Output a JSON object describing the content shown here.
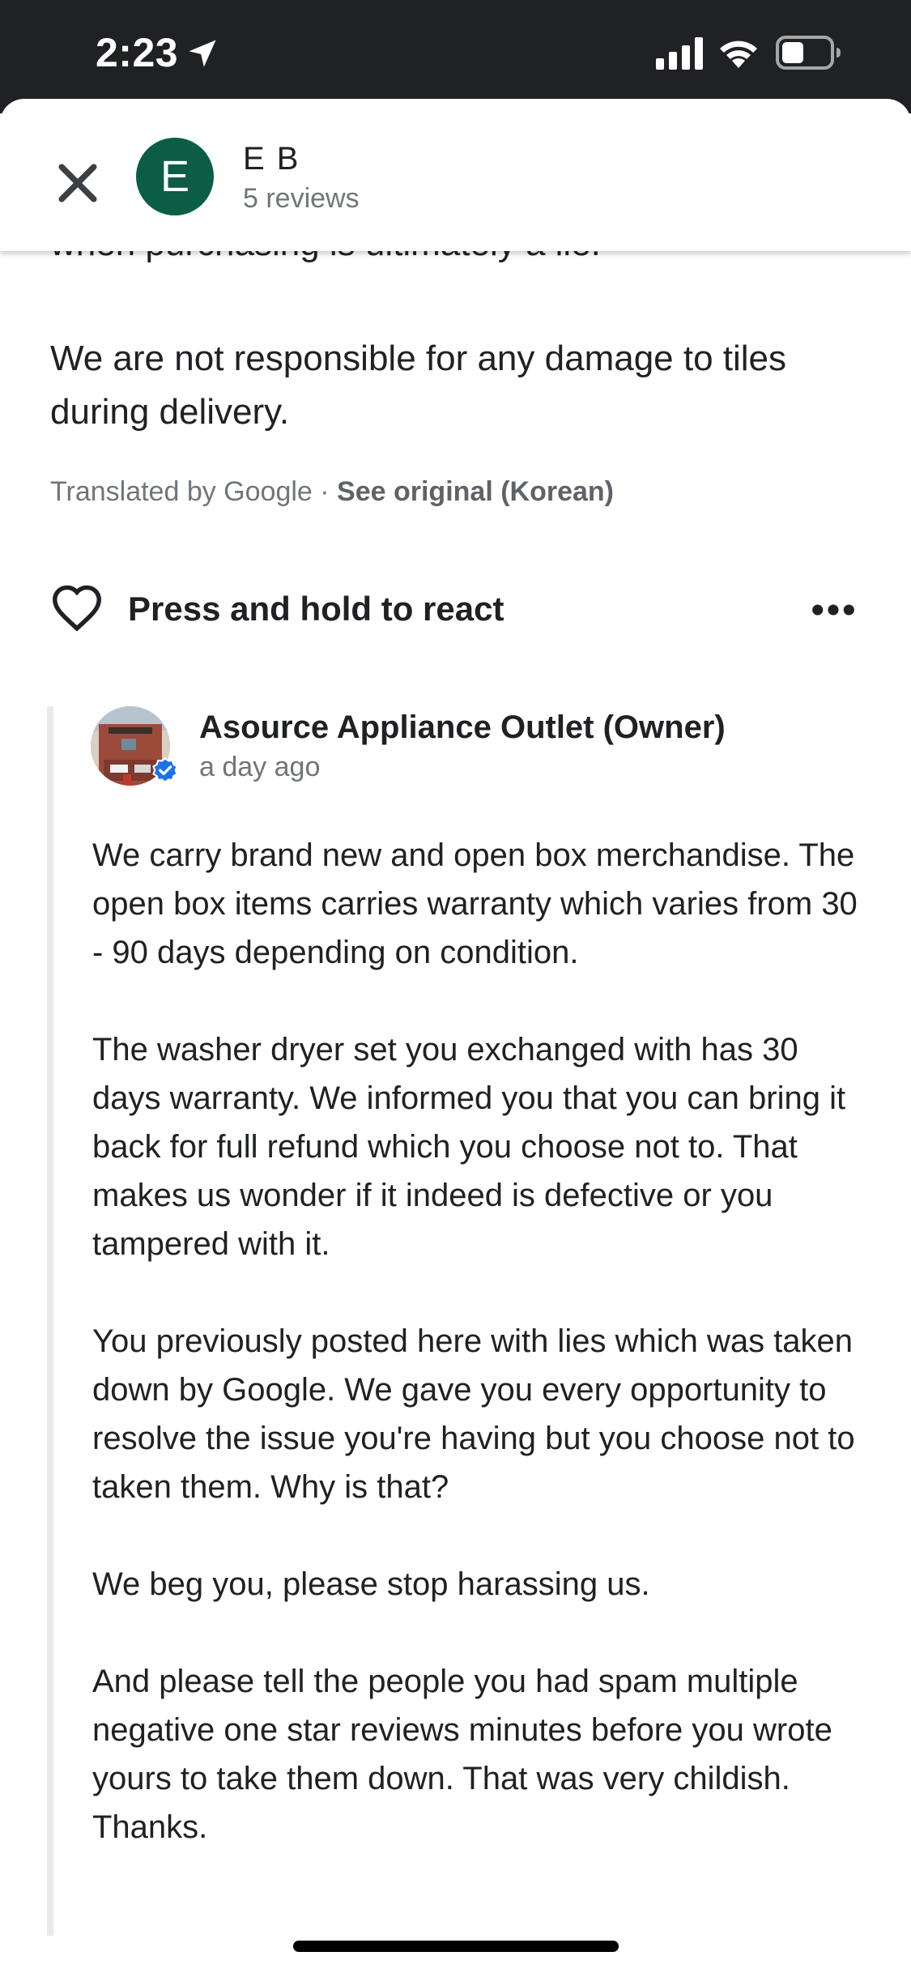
{
  "status_bar": {
    "time": "2:23"
  },
  "header": {
    "avatar_letter": "E",
    "reviewer_name": "E B",
    "review_count": "5 reviews",
    "avatar_color": "#0b5e45"
  },
  "review": {
    "clipped_line": "when purchasing is ultimately a lie.",
    "text": "We are not responsible for any damage to tiles during delivery.",
    "translated_by": "Translated by Google · ",
    "see_original": "See original (Korean)"
  },
  "reaction": {
    "label": "Press and hold to react"
  },
  "owner_reply": {
    "name": "Asource Appliance Outlet (Owner)",
    "time": "a day ago",
    "paragraphs": [
      "We carry brand new and open box merchandise. The open box items carries warranty which varies from 30 - 90 days depending on condition.",
      "The washer dryer set you exchanged with has 30 days warranty.  We informed you that you can bring it back for full refund which you choose not to. That makes us wonder if it indeed is defective or you tampered with it.",
      "You previously posted here with lies which was taken down by Google. We gave you every opportunity to resolve the issue you're having but you choose not to taken them.  Why is that?",
      "We beg you, please stop harassing us.",
      "And please tell the people you had spam multiple negative one star reviews minutes before you wrote yours to take them down. That was very childish. Thanks."
    ]
  },
  "icons": {
    "close": "close-icon",
    "heart": "heart-icon",
    "more": "more-horizontal-icon",
    "verified": "verified-badge-icon",
    "location": "location-arrow-icon"
  }
}
